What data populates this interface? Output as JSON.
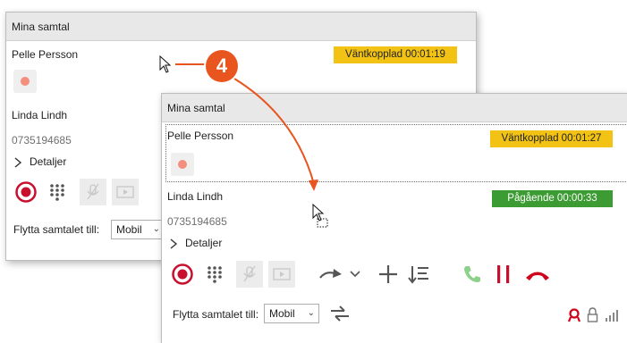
{
  "back_panel": {
    "title": "Mina samtal",
    "caller1_name": "Pelle Persson",
    "caller1_status": "Väntkopplad 00:01:19",
    "caller2_name": "Linda Lindh",
    "caller2_number": "0735194685",
    "details_label": "Detaljer",
    "move_label": "Flytta samtalet till:",
    "move_value": "Mobil"
  },
  "front_panel": {
    "title": "Mina samtal",
    "caller1_name": "Pelle Persson",
    "caller1_status": "Väntkopplad 00:01:27",
    "caller2_name": "Linda Lindh",
    "caller2_status": "Pågående 00:00:33",
    "caller2_number": "0735194685",
    "details_label": "Detaljer",
    "move_label": "Flytta samtalet till:",
    "move_value": "Mobil"
  },
  "annotation": {
    "step_number": "4"
  },
  "colors": {
    "hold": "#f2c314",
    "active": "#3c9b32",
    "record": "#c8102e",
    "answer": "#8bd18a",
    "hangup": "#d0021b",
    "annotation": "#e8551e"
  },
  "icons": [
    "record-icon",
    "keypad-icon",
    "mute-icon",
    "video-icon",
    "transfer-icon",
    "chevron-down-icon",
    "add-call-icon",
    "conference-list-icon",
    "answer-icon",
    "hold-icon",
    "hangup-icon",
    "swap-icon",
    "recording-status-icon",
    "lock-icon",
    "signal-icon",
    "chevron-right-icon",
    "mouse-cursor-icon",
    "drag-cursor-icon"
  ]
}
